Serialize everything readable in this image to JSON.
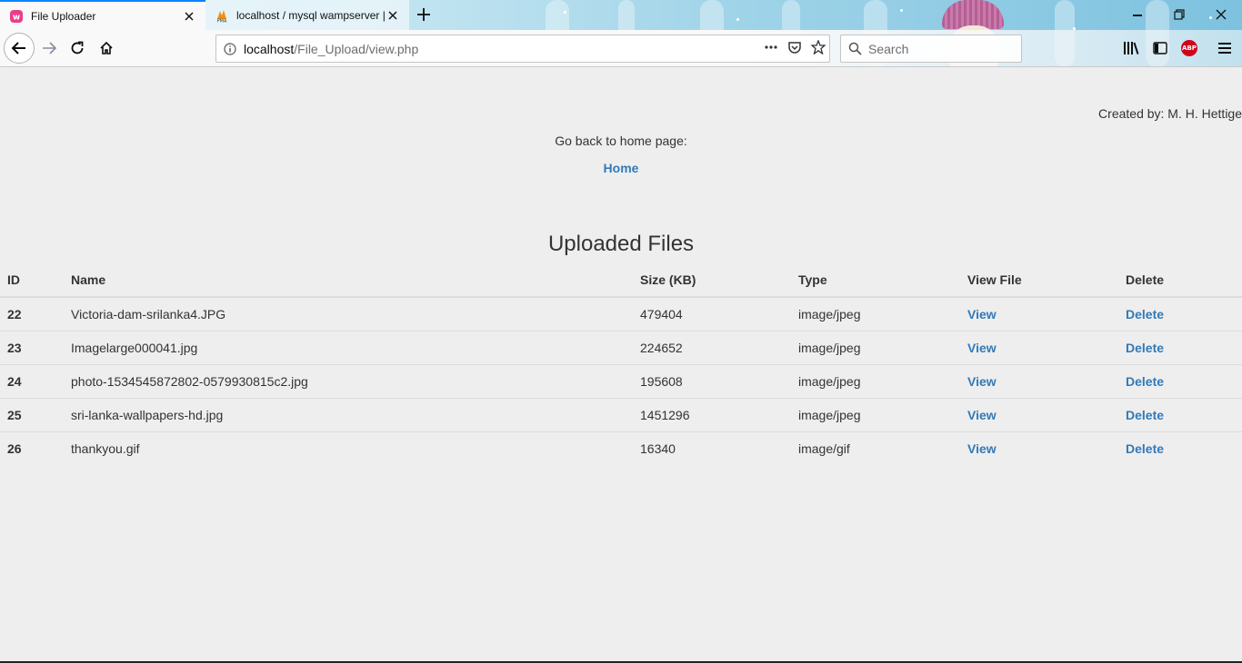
{
  "browser": {
    "tabs": [
      {
        "title": "File Uploader",
        "active": true
      },
      {
        "title": "localhost / mysql wampserver |",
        "active": false
      }
    ],
    "url_host": "localhost",
    "url_path": "/File_Upload/view.php",
    "search_placeholder": "Search",
    "abp_label": "ABP"
  },
  "page": {
    "creator": "Created by: M. H. Hettige",
    "go_back_text": "Go back to home page:",
    "home_link": "Home",
    "heading": "Uploaded Files"
  },
  "table": {
    "headers": [
      "ID",
      "Name",
      "Size (KB)",
      "Type",
      "View File",
      "Delete"
    ],
    "rows": [
      {
        "id": "22",
        "name": "Victoria-dam-srilanka4.JPG",
        "size": "479404",
        "type": "image/jpeg",
        "view": "View",
        "delete": "Delete"
      },
      {
        "id": "23",
        "name": "Imagelarge000041.jpg",
        "size": "224652",
        "type": "image/jpeg",
        "view": "View",
        "delete": "Delete"
      },
      {
        "id": "24",
        "name": "photo-1534545872802-0579930815c2.jpg",
        "size": "195608",
        "type": "image/jpeg",
        "view": "View",
        "delete": "Delete"
      },
      {
        "id": "25",
        "name": "sri-lanka-wallpapers-hd.jpg",
        "size": "1451296",
        "type": "image/jpeg",
        "view": "View",
        "delete": "Delete"
      },
      {
        "id": "26",
        "name": "thankyou.gif",
        "size": "16340",
        "type": "image/gif",
        "view": "View",
        "delete": "Delete"
      }
    ]
  },
  "colors": {
    "link": "#337ab7",
    "page_background": "#eeeeee",
    "text": "#333333",
    "active_tab_accent": "#0a84ff"
  }
}
